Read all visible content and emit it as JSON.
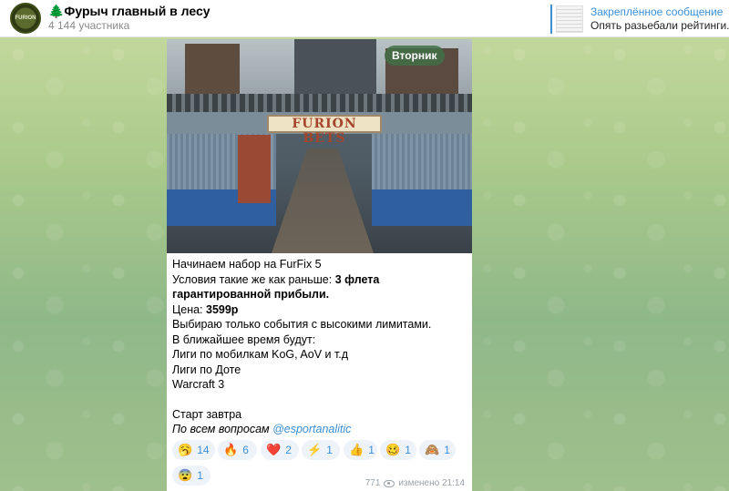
{
  "header": {
    "title": "🌲Фурыч главный в лесу",
    "subtitle": "4 144 участника",
    "avatar_text": "FURION"
  },
  "pinned": {
    "title": "Закреплённое сообщение",
    "text": "Опять разьебали рейтинги. ..."
  },
  "post": {
    "image": {
      "sign_text": "FURION BETS",
      "day_badge": "Вторник"
    },
    "lines": {
      "l1": "Начинаем набор на FurFix 5",
      "l2_prefix": "Условия такие же как раньше: ",
      "l2_bold": "3 флета",
      "l3_bold": "гарантированной прибыли.",
      "l4_prefix": "Цена: ",
      "l4_bold": "3599р",
      "l5": "Выбираю только события с высокими лимитами.",
      "l6": "В ближайшее время будут:",
      "l7": "Лиги по мобилкам KoG, AoV и т.д",
      "l8": "Лиги по Доте",
      "l9": "Warcraft 3",
      "l10": "Старт завтра",
      "l11_prefix": "По всем вопросам ",
      "l11_link": "@esportanalitic"
    },
    "reactions": [
      {
        "emoji": "🥱",
        "count": "14"
      },
      {
        "emoji": "🔥",
        "count": "6"
      },
      {
        "emoji": "❤️",
        "count": "2"
      },
      {
        "emoji": "⚡",
        "count": "1"
      },
      {
        "emoji": "👍",
        "count": "1"
      },
      {
        "emoji": "🥴",
        "count": "1"
      },
      {
        "emoji": "🙈",
        "count": "1"
      },
      {
        "emoji": "😨",
        "count": "1"
      }
    ],
    "meta": {
      "views": "771",
      "edited": "изменено 21:14"
    }
  },
  "colors": {
    "accent": "#3a8fd6",
    "reaction_bg": "#eef3f9",
    "badge": "#426e46"
  }
}
